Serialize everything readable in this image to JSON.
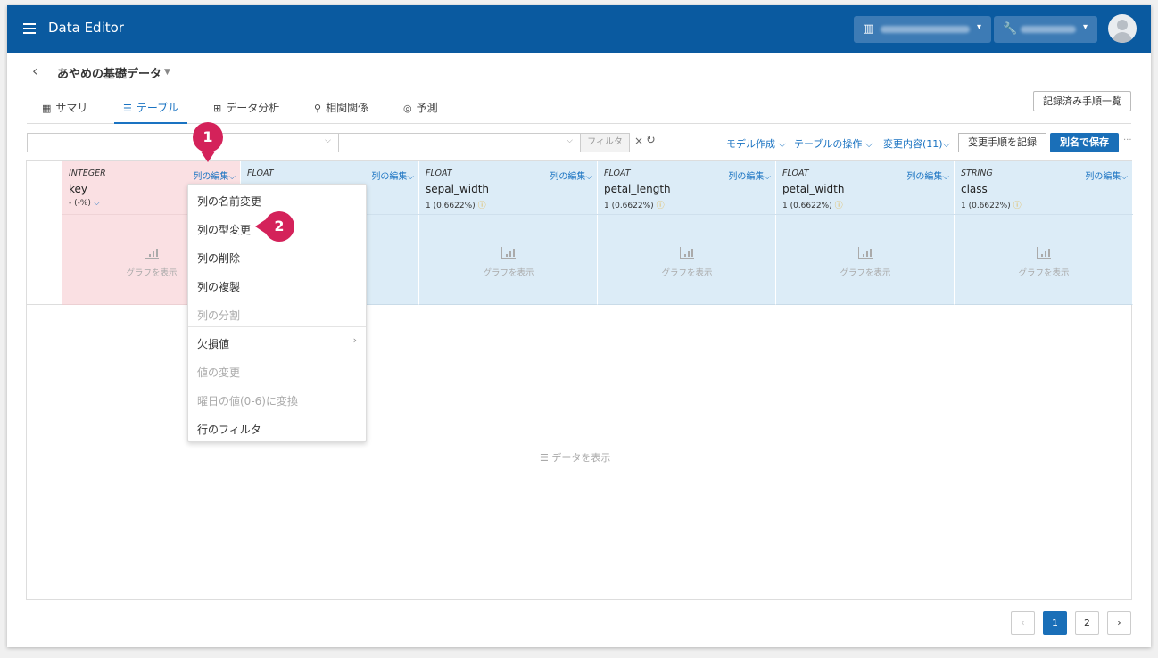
{
  "app": {
    "title": "Data Editor"
  },
  "header": {
    "org_icon": "building-icon",
    "project_icon": "wrench-icon"
  },
  "dataset": {
    "title": "あやめの基礎データ"
  },
  "tabs": [
    {
      "label": "サマリ",
      "icon": "grid-icon"
    },
    {
      "label": "テーブル",
      "icon": "list-icon",
      "active": true
    },
    {
      "label": "データ分析",
      "icon": "plus-square-icon"
    },
    {
      "label": "相関関係",
      "icon": "lightbulb-icon"
    },
    {
      "label": "予測",
      "icon": "chart-search-icon"
    }
  ],
  "toolbar": {
    "history_button": "記録済み手順一覧",
    "filter_button": "フィルタ",
    "model_create": "モデル作成",
    "table_ops": "テーブルの操作",
    "changes": "変更内容(11)",
    "record_button": "変更手順を記録",
    "save_as_button": "別名で保存"
  },
  "columns": [
    {
      "type": "INTEGER",
      "name": "key",
      "stat": "- (-%)",
      "edit": "列の編集",
      "graph": "グラフを表示",
      "highlight": true
    },
    {
      "type": "FLOAT",
      "name": "",
      "stat": "",
      "edit": "列の編集",
      "graph": "グラフを表示"
    },
    {
      "type": "FLOAT",
      "name": "sepal_width",
      "stat": "1 (0.6622%)",
      "edit": "列の編集",
      "graph": "グラフを表示"
    },
    {
      "type": "FLOAT",
      "name": "petal_length",
      "stat": "1 (0.6622%)",
      "edit": "列の編集",
      "graph": "グラフを表示"
    },
    {
      "type": "FLOAT",
      "name": "petal_width",
      "stat": "1 (0.6622%)",
      "edit": "列の編集",
      "graph": "グラフを表示"
    },
    {
      "type": "STRING",
      "name": "class",
      "stat": "1 (0.6622%)",
      "edit": "列の編集",
      "graph": "グラフを表示"
    }
  ],
  "column_menu": {
    "items": [
      {
        "label": "列の名前変更",
        "disabled": false
      },
      {
        "label": "列の型変更",
        "disabled": false
      },
      {
        "label": "列の削除",
        "disabled": false
      },
      {
        "label": "列の複製",
        "disabled": false
      },
      {
        "label": "列の分割",
        "disabled": true
      },
      {
        "label": "欠損値",
        "disabled": false,
        "submenu": true
      },
      {
        "label": "値の変更",
        "disabled": true
      },
      {
        "label": "曜日の値(0-6)に変換",
        "disabled": true
      },
      {
        "label": "行のフィルタ",
        "disabled": false
      }
    ]
  },
  "body": {
    "show_data": "データを表示"
  },
  "callouts": {
    "step1": "1",
    "step2": "2"
  },
  "pagination": {
    "prev": "‹",
    "pages": [
      "1",
      "2"
    ],
    "current": "1",
    "next": "›"
  },
  "colors": {
    "header_bg": "#0a5aa0",
    "accent": "#1a73c2",
    "callout": "#d4225a",
    "key_col": "#fae0e3",
    "col_bg": "#dcecf7"
  }
}
